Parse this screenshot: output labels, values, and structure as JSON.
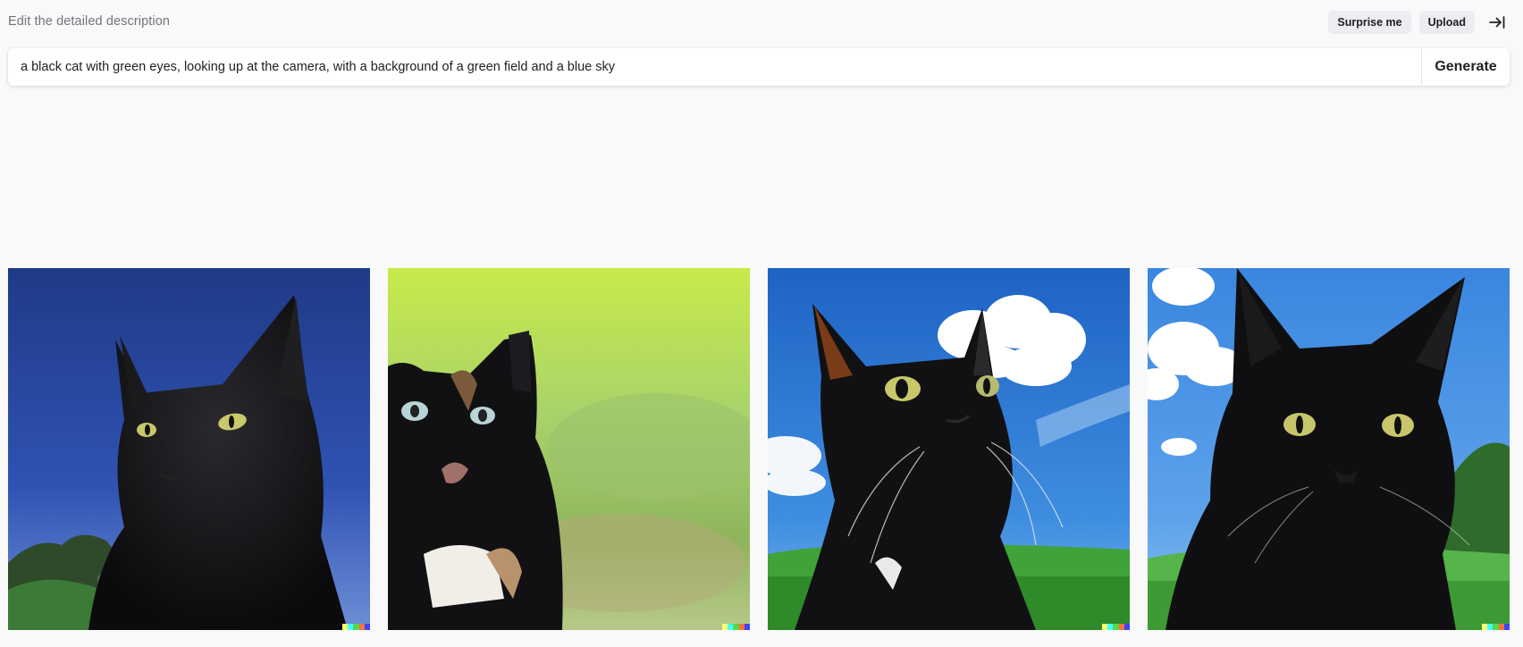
{
  "header": {
    "label": "Edit the detailed description",
    "surprise_label": "Surprise me",
    "upload_label": "Upload"
  },
  "prompt": {
    "value": "a black cat with green eyes, looking up at the camera, with a background of a green field and a blue sky",
    "generate_label": "Generate"
  },
  "gallery": {
    "images": [
      {
        "description": "black cat against deep blue sky with trees at bottom left"
      },
      {
        "description": "black and calico cat in blurred green field"
      },
      {
        "description": "black cat looking up against blue sky with white clouds over grass"
      },
      {
        "description": "black cat facing camera under blue sky with clouds over grass"
      }
    ],
    "signature_colors": [
      "#ffff66",
      "#42ffff",
      "#51da4c",
      "#ff6e3c",
      "#3c46ff"
    ]
  },
  "icons": {
    "collapse": "arrow-right-to-bar-icon"
  }
}
